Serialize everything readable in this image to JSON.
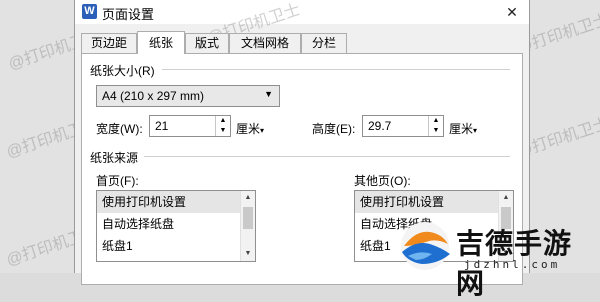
{
  "window": {
    "icon_label": "W",
    "title": "页面设置",
    "close_glyph": "✕"
  },
  "watermark": "@打印机卫士",
  "tabs": [
    {
      "label": "页边距",
      "active": false
    },
    {
      "label": "纸张",
      "active": true
    },
    {
      "label": "版式",
      "active": false
    },
    {
      "label": "文档网格",
      "active": false
    },
    {
      "label": "分栏",
      "active": false
    }
  ],
  "paper_size": {
    "group_label": "纸张大小(R)",
    "selected": "A4 (210 x 297 mm)",
    "width_label": "宽度(W):",
    "width_value": "21",
    "width_unit": "厘米",
    "height_label": "高度(E):",
    "height_value": "29.7",
    "height_unit": "厘米"
  },
  "paper_source": {
    "group_label": "纸张来源",
    "first_page": {
      "label": "首页(F):",
      "items": [
        "使用打印机设置",
        "自动选择纸盘",
        "纸盘1"
      ],
      "selected_index": 0
    },
    "other_pages": {
      "label": "其他页(O):",
      "items": [
        "使用打印机设置",
        "自动选择纸盘",
        "纸盘1"
      ],
      "selected_index": 0
    }
  },
  "logo": {
    "text": "吉德手游网",
    "subtext": "jdzhnl.com"
  },
  "colors": {
    "accent": "#2b5fb8",
    "logo_blue": "#1e6fd0",
    "logo_orange": "#f08a1c"
  },
  "icons": [
    "app-icon",
    "close-icon",
    "dropdown-arrow-icon",
    "spin-up-icon",
    "spin-down-icon",
    "scroll-up-icon",
    "scroll-down-icon"
  ]
}
